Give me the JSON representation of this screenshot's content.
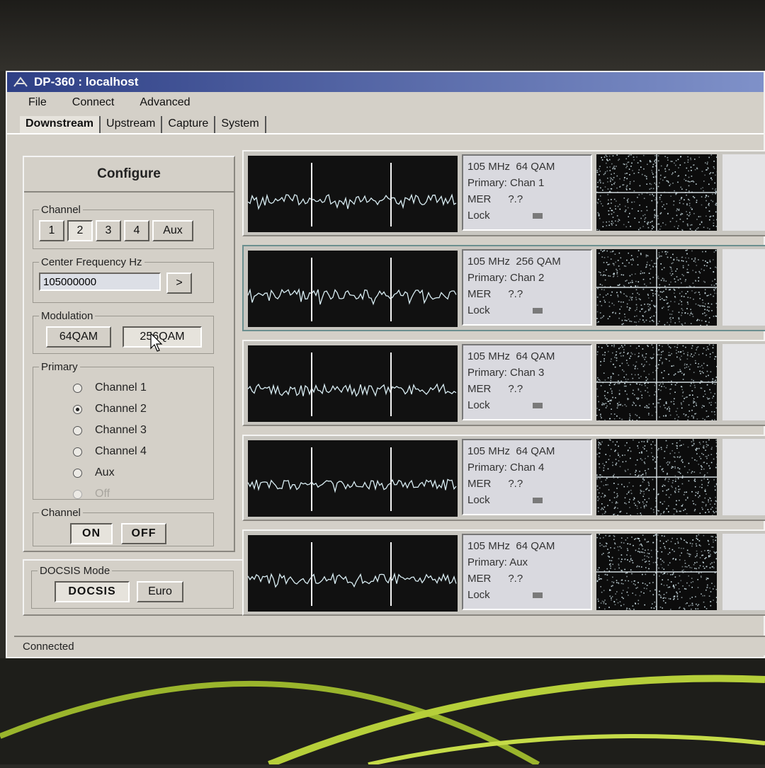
{
  "window": {
    "title": "DP-360 : localhost",
    "status": "Connected"
  },
  "menu": {
    "file": "File",
    "connect": "Connect",
    "advanced": "Advanced"
  },
  "tabs": [
    {
      "label": "Downstream",
      "active": true
    },
    {
      "label": "Upstream"
    },
    {
      "label": "Capture"
    },
    {
      "label": "System"
    }
  ],
  "configure": {
    "title": "Configure",
    "channel_group": {
      "legend": "Channel",
      "buttons": [
        "1",
        "2",
        "3",
        "4",
        "Aux"
      ],
      "selected": "2"
    },
    "center_frequency": {
      "legend": "Center Frequency Hz",
      "value": "105000000",
      "go_label": ">"
    },
    "modulation": {
      "legend": "Modulation",
      "options": [
        "64QAM",
        "256QAM"
      ],
      "selected": "256QAM"
    },
    "primary": {
      "legend": "Primary",
      "options": [
        "Channel 1",
        "Channel 2",
        "Channel 3",
        "Channel 4",
        "Aux",
        "Off"
      ],
      "selected": "Channel 2",
      "disabled": "Off"
    },
    "channel_power": {
      "legend": "Channel",
      "on": "ON",
      "off": "OFF"
    }
  },
  "docsis_mode": {
    "legend": "DOCSIS Mode",
    "docsis": "DOCSIS",
    "euro": "Euro"
  },
  "channels": [
    {
      "freq": "105 MHz",
      "mod": "64 QAM",
      "primary_label": "Primary:",
      "primary": "Chan 1",
      "mer_label": "MER",
      "mer": "?.?",
      "lock_label": "Lock"
    },
    {
      "freq": "105 MHz",
      "mod": "256 QAM",
      "primary_label": "Primary:",
      "primary": "Chan 2",
      "mer_label": "MER",
      "mer": "?.?",
      "lock_label": "Lock"
    },
    {
      "freq": "105 MHz",
      "mod": "64 QAM",
      "primary_label": "Primary:",
      "primary": "Chan 3",
      "mer_label": "MER",
      "mer": "?.?",
      "lock_label": "Lock"
    },
    {
      "freq": "105 MHz",
      "mod": "64 QAM",
      "primary_label": "Primary:",
      "primary": "Chan 4",
      "mer_label": "MER",
      "mer": "?.?",
      "lock_label": "Lock"
    },
    {
      "freq": "105 MHz",
      "mod": "64 QAM",
      "primary_label": "Primary:",
      "primary": "Aux",
      "mer_label": "MER",
      "mer": "?.?",
      "lock_label": "Lock"
    }
  ],
  "colors": {
    "trace": "#d8ecf2",
    "display_bg": "#111111",
    "title_bar": "#2e3f85"
  }
}
